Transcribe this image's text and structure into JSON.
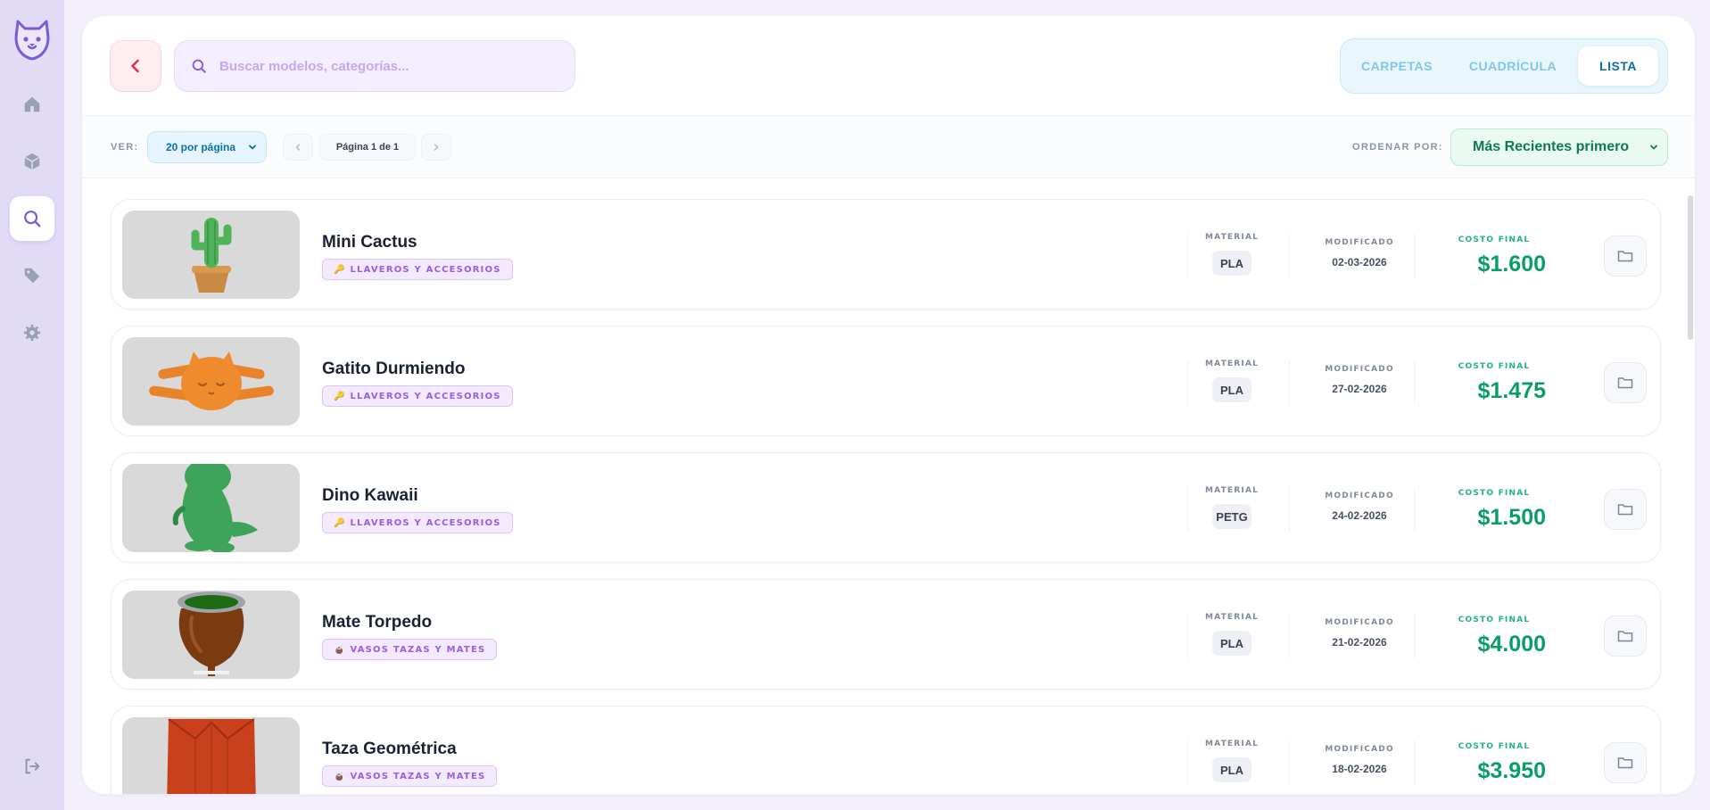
{
  "search": {
    "placeholder": "Buscar modelos, categorías..."
  },
  "view_tabs": [
    "CARPETAS",
    "CUADRÍCULA",
    "LISTA"
  ],
  "active_view": "LISTA",
  "toolbar": {
    "ver_label": "VER:",
    "per_page": "20 por página",
    "page_info": "Página 1 de 1",
    "sort_label": "ORDENAR POR:",
    "sort_value": "Más Recientes primero"
  },
  "columns": {
    "material": "MATERIAL",
    "modified": "MODIFICADO",
    "cost": "COSTO FINAL"
  },
  "items": [
    {
      "name": "Mini Cactus",
      "category_icon": "🔑",
      "category": "LLAVEROS Y ACCESORIOS",
      "material": "PLA",
      "modified": "02-03-2026",
      "cost": "$1.600",
      "thumb": "cactus"
    },
    {
      "name": "Gatito Durmiendo",
      "category_icon": "🔑",
      "category": "LLAVEROS Y ACCESORIOS",
      "material": "PLA",
      "modified": "27-02-2026",
      "cost": "$1.475",
      "thumb": "cat"
    },
    {
      "name": "Dino Kawaii",
      "category_icon": "🔑",
      "category": "LLAVEROS Y ACCESORIOS",
      "material": "PETG",
      "modified": "24-02-2026",
      "cost": "$1.500",
      "thumb": "dino"
    },
    {
      "name": "Mate Torpedo",
      "category_icon": "🧉",
      "category": "VASOS TAZAS Y MATES",
      "material": "PLA",
      "modified": "21-02-2026",
      "cost": "$4.000",
      "thumb": "mate"
    },
    {
      "name": "Taza Geométrica",
      "category_icon": "🧉",
      "category": "VASOS TAZAS Y MATES",
      "material": "PLA",
      "modified": "18-02-2026",
      "cost": "$3.950",
      "thumb": "cup"
    }
  ],
  "colors": {
    "sidebar": "#e2dbf6",
    "accent_purple": "#7c5ad9",
    "accent_blue": "#0c6fa8",
    "accent_green": "#0a9e66",
    "back_red": "#e0304f"
  },
  "sidebar_icons": [
    "bear-logo-icon",
    "home-icon",
    "cube-icon",
    "search-icon",
    "tag-icon",
    "gear-icon",
    "logout-icon"
  ]
}
